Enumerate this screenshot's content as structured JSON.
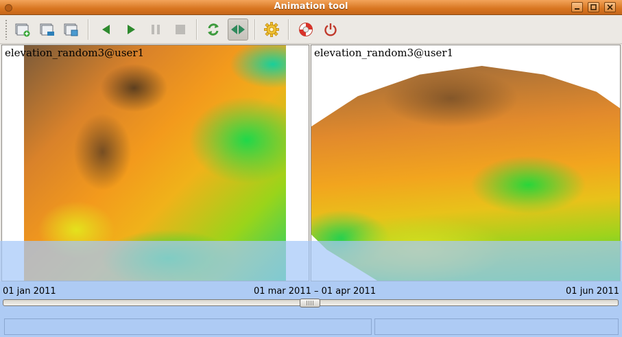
{
  "window": {
    "title": "Animation tool"
  },
  "toolbar": {
    "buttons": [
      {
        "name": "add-view-icon",
        "tooltip": ""
      },
      {
        "name": "remove-view-icon",
        "tooltip": ""
      },
      {
        "name": "edit-view-icon",
        "tooltip": ""
      },
      {
        "name": "play-backward-icon",
        "tooltip": ""
      },
      {
        "name": "play-forward-icon",
        "tooltip": ""
      },
      {
        "name": "pause-icon",
        "tooltip": ""
      },
      {
        "name": "stop-icon",
        "tooltip": ""
      },
      {
        "name": "loop-icon",
        "tooltip": ""
      },
      {
        "name": "bounce-icon",
        "tooltip": ""
      },
      {
        "name": "gear-icon",
        "tooltip": ""
      },
      {
        "name": "help-lifebuoy-icon",
        "tooltip": ""
      },
      {
        "name": "power-icon",
        "tooltip": ""
      }
    ],
    "active": "bounce-icon"
  },
  "views": {
    "left_label": "elevation_random3@user1",
    "right_label": "elevation_random3@user1"
  },
  "timeline": {
    "start": "01 jan 2011",
    "current": "01 mar 2011 – 01 apr 2011",
    "end": "01 jun 2011",
    "position_fraction": 0.5
  },
  "colors": {
    "titlebar": "#d87520",
    "selection": "#aecbf4"
  }
}
